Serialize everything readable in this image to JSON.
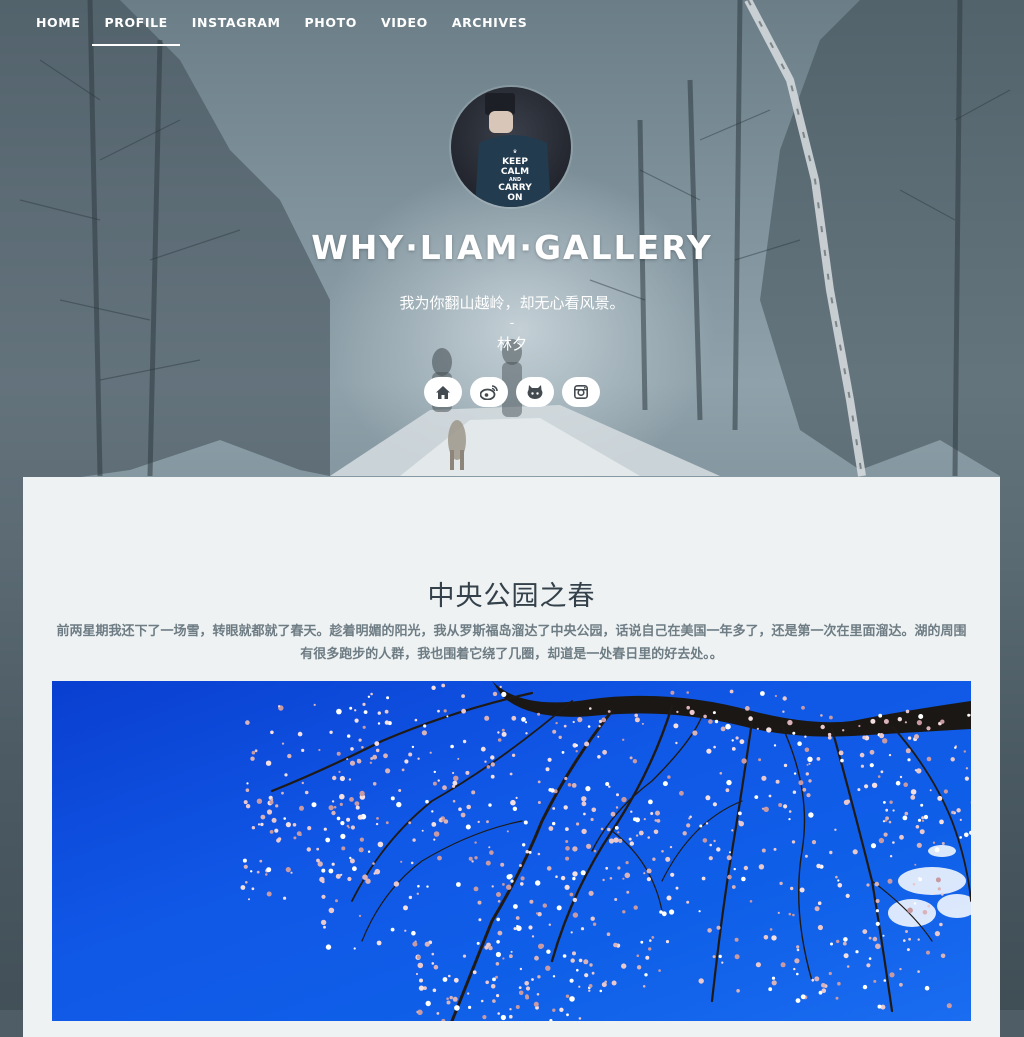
{
  "nav": {
    "items": [
      {
        "label": "HOME"
      },
      {
        "label": "PROFILE"
      },
      {
        "label": "INSTAGRAM"
      },
      {
        "label": "PHOTO"
      },
      {
        "label": "VIDEO"
      },
      {
        "label": "ARCHIVES"
      }
    ],
    "active": "PROFILE"
  },
  "header": {
    "avatar_text": [
      "KEEP",
      "CALM",
      "AND",
      "CARRY",
      "ON"
    ],
    "title": "WHY·LIAM·GALLERY",
    "motto": "我为你翻山越岭，却无心看风景。",
    "separator": "-",
    "author": "林夕",
    "socials": [
      {
        "icon": "home-icon"
      },
      {
        "icon": "weibo-icon"
      },
      {
        "icon": "github-icon"
      },
      {
        "icon": "instagram-icon"
      }
    ]
  },
  "post": {
    "title": "中央公园之春",
    "excerpt": "前两星期我还下了一场雪，转眼就都就了春天。趁着明媚的阳光，我从罗斯福岛溜达了中央公园，话说自己在美国一年多了，还是第一次在里面溜达。湖的周围有很多跑步的人群，我也围着它绕了几圈，却道是一处春日里的好去处。。"
  },
  "colors": {
    "card_bg": "#eef2f3",
    "title_text": "#34414a",
    "excerpt_text": "#6e7c84",
    "sky_blue": "#1057e6"
  }
}
